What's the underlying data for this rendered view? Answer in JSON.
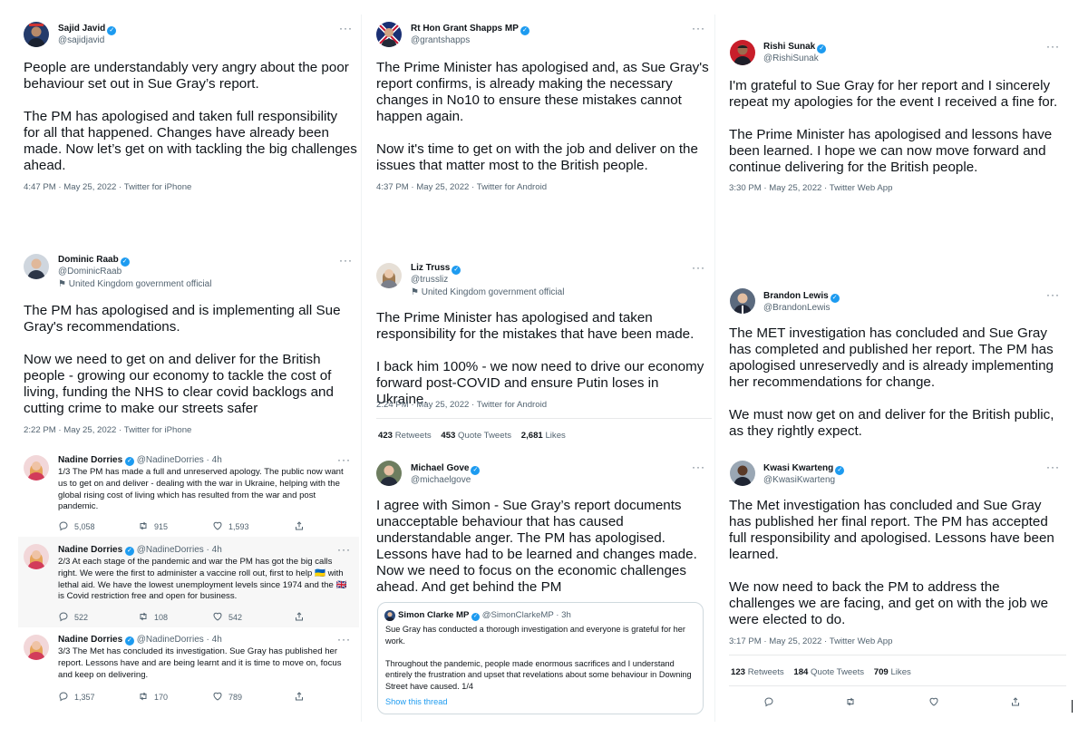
{
  "tweets": {
    "javid": {
      "name": "Sajid Javid",
      "handle": "@sajidjavid",
      "text": "People are understandably very angry about the poor behaviour set out in Sue Gray’s report.\n\nThe PM has apologised and taken full responsibility for all that happened. Changes have already been made. Now let’s get on with tackling the big challenges ahead.",
      "meta": "4:47 PM · May 25, 2022 · Twitter for iPhone"
    },
    "shapps": {
      "name": "Rt Hon Grant Shapps MP",
      "handle": "@grantshapps",
      "text": "The Prime Minister has apologised and, as Sue Gray's report confirms, is already making the necessary changes in No10 to ensure these mistakes cannot happen again.\n\nNow it's time to get on with the job and deliver on the issues that matter most to the British people.",
      "meta": "4:37 PM · May 25, 2022 · Twitter for Android"
    },
    "sunak": {
      "name": "Rishi Sunak",
      "handle": "@RishiSunak",
      "text": "I'm grateful to Sue Gray for her report and I sincerely repeat my apologies for the event I received a fine for.\n\nThe Prime Minister has apologised and lessons have been learned. I hope we can now move forward and continue delivering for the British people.",
      "meta": "3:30 PM · May 25, 2022 · Twitter Web App"
    },
    "raab": {
      "name": "Dominic Raab",
      "handle": "@DominicRaab",
      "gov": "United Kingdom government official",
      "text": "The PM has apologised and is implementing all Sue Gray's recommendations.\n\nNow we need to get on and deliver for the British people - growing our economy to tackle the cost of living, funding the NHS to clear covid backlogs and cutting crime to make our streets safer",
      "meta": "2:22 PM · May 25, 2022 · Twitter for iPhone"
    },
    "truss": {
      "name": "Liz Truss",
      "handle": "@trussliz",
      "gov": "United Kingdom government official",
      "text": "The Prime Minister has apologised and taken responsibility for the mistakes that have been made.\n\nI back him 100% - we now need to drive our economy forward post-COVID and ensure Putin loses in Ukraine.",
      "meta": "2:24 PM · May 25, 2022 · Twitter for Android",
      "retweets": "423",
      "retweets_label": "Retweets",
      "quotes": "453",
      "quotes_label": "Quote Tweets",
      "likes": "2,681",
      "likes_label": "Likes"
    },
    "lewis": {
      "name": "Brandon Lewis",
      "handle": "@BrandonLewis",
      "text": "The MET investigation has concluded and Sue Gray has completed and published her report. The PM has apologised unreservedly and is already implementing her recommendations for change.\n\nWe must now get on and deliver for the British public, as they rightly expect."
    },
    "gove": {
      "name": "Michael Gove",
      "handle": "@michaelgove",
      "text": "I agree with Simon - Sue Gray’s report documents unacceptable behaviour that has caused understandable anger. The PM has apologised. Lessons have had to be learned and changes made. Now we need to focus on the economic challenges ahead. And get behind the PM",
      "quote": {
        "name": "Simon Clarke MP",
        "handle": "@SimonClarkeMP · 3h",
        "text": "Sue Gray has conducted a thorough investigation and everyone is grateful for her work.\n\nThroughout the pandemic, people made enormous sacrifices and I understand entirely the frustration and upset that revelations about some behaviour in Downing Street have caused. 1/4",
        "link": "Show this thread"
      }
    },
    "kwarteng": {
      "name": "Kwasi Kwarteng",
      "handle": "@KwasiKwarteng",
      "text": "The Met investigation has concluded and Sue Gray has published her final report. The PM has accepted full responsibility and apologised. Lessons have been learned.\n\nWe now need to back the PM to address the challenges we are facing, and get on with the job we were elected to do.",
      "meta": "3:17 PM · May 25, 2022 · Twitter Web App",
      "retweets": "123",
      "retweets_label": "Retweets",
      "quotes": "184",
      "quotes_label": "Quote Tweets",
      "likes": "709",
      "likes_label": "Likes"
    }
  },
  "dorries": [
    {
      "name": "Nadine Dorries",
      "handle": "@NadineDorries · 4h",
      "text": "1/3 The PM has made a full and unreserved apology. The public now want us to get on and deliver - dealing with the war in Ukraine,  helping with the global rising cost of living which has resulted from the war and post pandemic.",
      "replies": "5,058",
      "retweets": "915",
      "likes": "1,593"
    },
    {
      "name": "Nadine Dorries",
      "handle": "@NadineDorries · 4h",
      "text": "2/3 At each stage of the pandemic and war the PM has got the big calls right. We were the first to administer a vaccine roll out, first to help 🇺🇦 with lethal aid. We have the lowest unemployment levels since 1974 and the 🇬🇧 is Covid restriction free and open for business.",
      "replies": "522",
      "retweets": "108",
      "likes": "542"
    },
    {
      "name": "Nadine Dorries",
      "handle": "@NadineDorries · 4h",
      "text": "3/3 The Met has concluded its investigation. Sue Gray has published her report. Lessons have and are being learnt and it is time to move on, focus and keep on delivering.",
      "replies": "1,357",
      "retweets": "170",
      "likes": "789"
    }
  ],
  "icons": {
    "verified": "verified-badge-icon",
    "more": "more-options-icon",
    "reply": "reply-icon",
    "retweet": "retweet-icon",
    "like": "like-icon",
    "share": "share-icon",
    "gov_flag": "government-flag-icon"
  },
  "colors": {
    "accent": "#1d9bf0",
    "muted": "#536471",
    "text": "#0f1419"
  }
}
